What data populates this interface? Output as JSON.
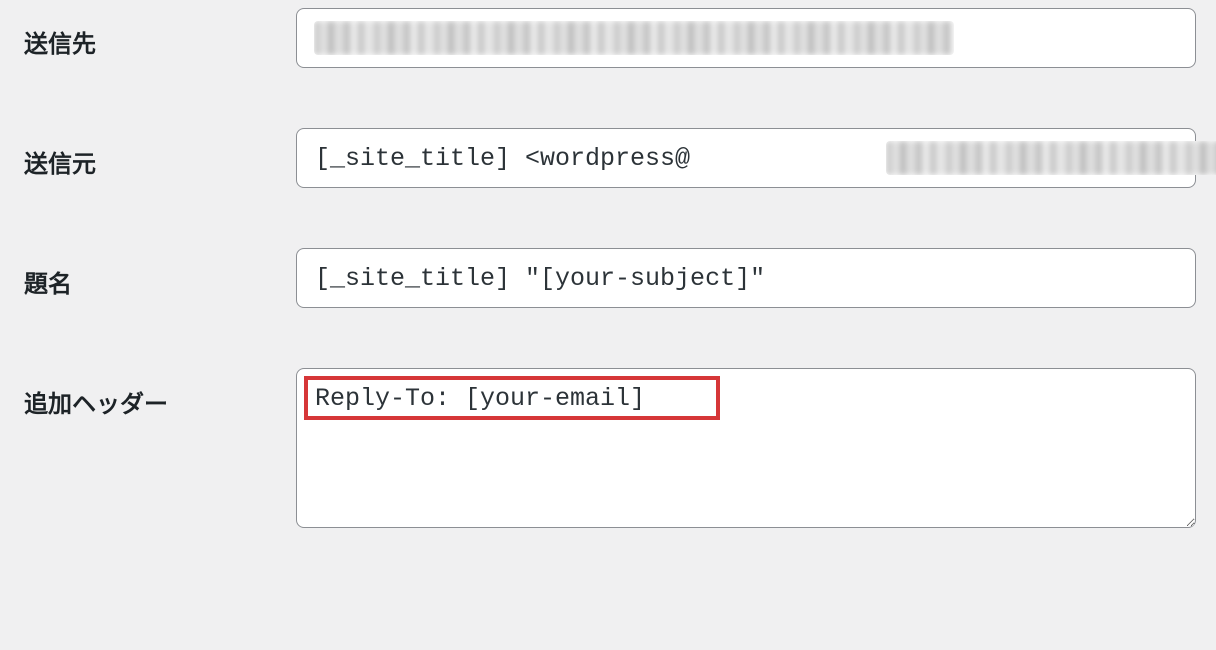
{
  "mail": {
    "to": {
      "label": "送信先",
      "value": ""
    },
    "from": {
      "label": "送信元",
      "value": "[_site_title] <wordpress@                        >"
    },
    "subject": {
      "label": "題名",
      "value": "[_site_title] \"[your-subject]\""
    },
    "additional_headers": {
      "label": "追加ヘッダー",
      "value": "Reply-To: [your-email]"
    }
  }
}
